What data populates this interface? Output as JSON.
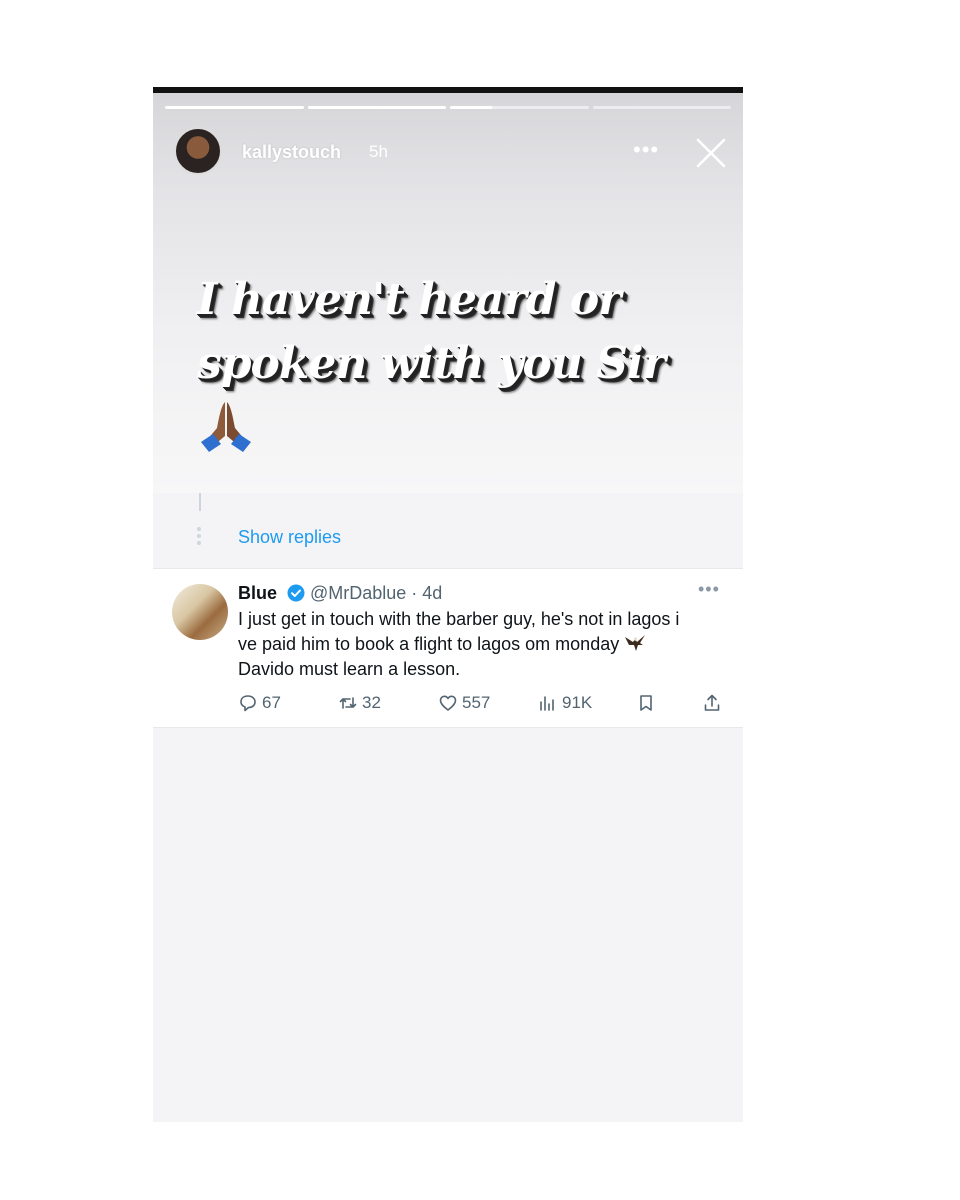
{
  "story": {
    "username": "kallystouch",
    "time": "5h",
    "more": "•••",
    "progress": [
      1,
      1,
      0.3,
      0
    ],
    "text_line1": "I haven't heard or",
    "text_line2": "spoken with you Sir",
    "emoji": "folded-hands-emoji"
  },
  "thread": {
    "show_replies": "Show replies"
  },
  "tweet": {
    "name": "Blue",
    "handle_time": "@MrDablue · 4d",
    "more": "•••",
    "line1": "I just get in touch with the barber guy, he's not in lagos i",
    "line2": "ve paid him to book a flight to lagos om monday",
    "line3": "Davido must learn a lesson.",
    "replies": "67",
    "retweets": "32",
    "likes": "557",
    "views": "91K"
  },
  "colors": {
    "link": "#1d9bf0",
    "verified": "#1d9bf0",
    "muted": "#536471"
  }
}
